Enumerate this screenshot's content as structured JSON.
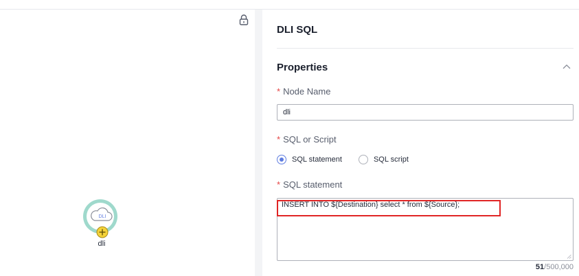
{
  "canvas": {
    "node": {
      "badge": "DLI",
      "label": "dli"
    }
  },
  "panel": {
    "title": "DLI SQL",
    "section_title": "Properties",
    "node_name": {
      "label": "Node Name",
      "value": "dli"
    },
    "sql_or_script": {
      "label": "SQL or Script",
      "options": [
        {
          "label": "SQL statement",
          "selected": true
        },
        {
          "label": "SQL script",
          "selected": false
        }
      ]
    },
    "sql_statement": {
      "label": "SQL statement",
      "value": "INSERT INTO ${Destination} select * from ${Source};",
      "count_current": "51",
      "count_max": "/500,000"
    },
    "required_mark": "*"
  },
  "colors": {
    "accent": "#5e7ce0",
    "required": "#e54545",
    "highlight_border": "#e02424",
    "node_ring": "#9fd9cc",
    "plus_fill": "#f5d33a"
  },
  "icons": {
    "lock": "lock-icon",
    "collapse": "chevron-up-icon",
    "node_type": "cloud-icon",
    "add": "plus-circle-icon"
  }
}
